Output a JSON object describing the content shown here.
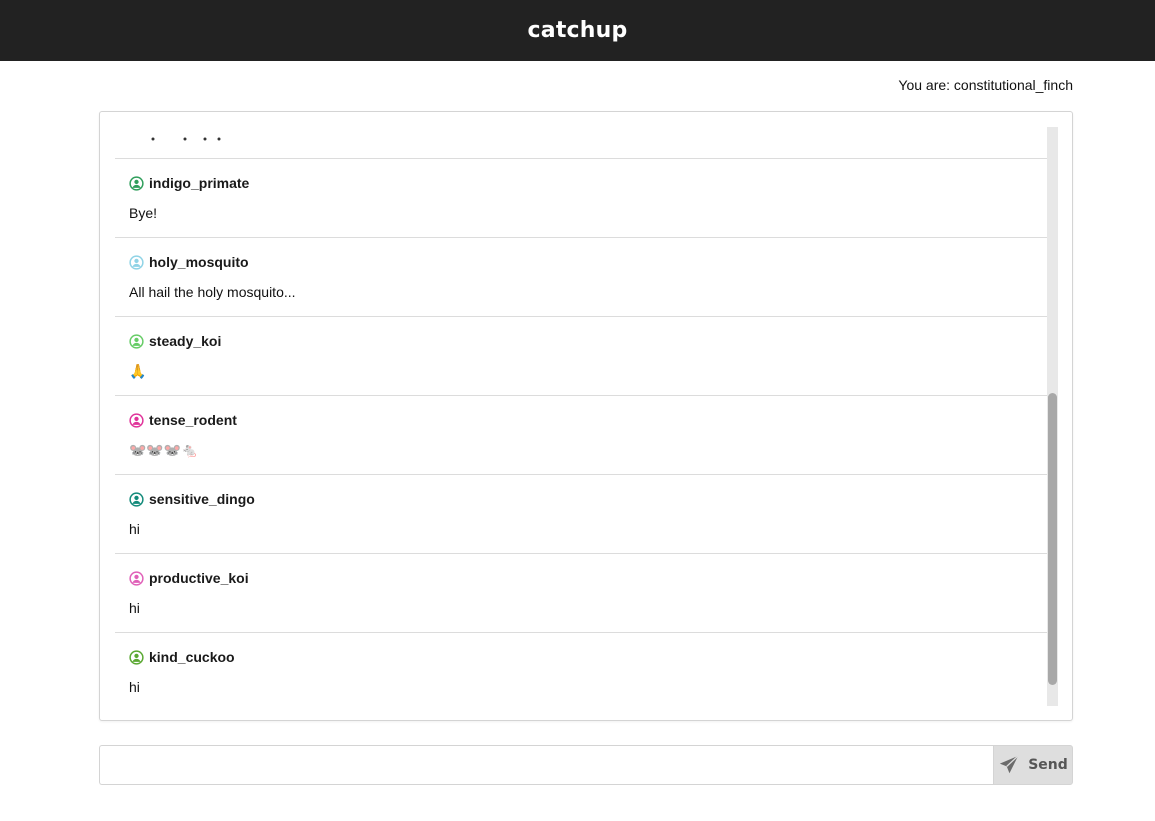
{
  "header": {
    "title": "catchup"
  },
  "session": {
    "you_are": "You are: constitutional_finch"
  },
  "messages": [
    {
      "user": "indigo_primate",
      "text": "Bye!",
      "color": "#2f9e5b",
      "icon": "user-icon"
    },
    {
      "user": "holy_mosquito",
      "text": "All hail the holy mosquito...",
      "color": "#8fd3e6",
      "icon": "user-icon"
    },
    {
      "user": "steady_koi",
      "text": "🙏",
      "color": "#66cc66",
      "icon": "user-icon"
    },
    {
      "user": "tense_rodent",
      "text": "🐭🐭🐭🐁",
      "color": "#e0339a",
      "icon": "user-icon"
    },
    {
      "user": "sensitive_dingo",
      "text": "hi",
      "color": "#128a7a",
      "icon": "user-icon"
    },
    {
      "user": "productive_koi",
      "text": "hi",
      "color": "#e060b8",
      "icon": "user-icon"
    },
    {
      "user": "kind_cuckoo",
      "text": "hi",
      "color": "#5aa832",
      "icon": "user-icon"
    }
  ],
  "composer": {
    "placeholder": "",
    "value": "",
    "send_label": "Send",
    "send_icon": "paper-plane-icon"
  },
  "scroll": {
    "position_fraction": 0.93
  }
}
